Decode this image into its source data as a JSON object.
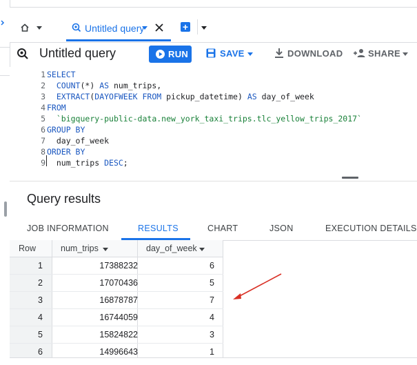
{
  "tabs": {
    "query_tab_label": "Untitled query"
  },
  "toolbar": {
    "title": "Untitled query",
    "run_label": "RUN",
    "save_label": "SAVE",
    "download_label": "DOWNLOAD",
    "share_label": "SHARE"
  },
  "editor": {
    "lines": [
      {
        "num": "1",
        "parts": [
          {
            "t": "kw",
            "v": "SELECT"
          }
        ]
      },
      {
        "num": "2",
        "parts": [
          {
            "t": "txt",
            "v": "  "
          },
          {
            "t": "kw",
            "v": "COUNT"
          },
          {
            "t": "txt",
            "v": "(*) "
          },
          {
            "t": "kw",
            "v": "AS"
          },
          {
            "t": "txt",
            "v": " num_trips,"
          }
        ]
      },
      {
        "num": "3",
        "parts": [
          {
            "t": "txt",
            "v": "  "
          },
          {
            "t": "kw",
            "v": "EXTRACT"
          },
          {
            "t": "txt",
            "v": "("
          },
          {
            "t": "kw",
            "v": "DAYOFWEEK FROM"
          },
          {
            "t": "txt",
            "v": " pickup_datetime) "
          },
          {
            "t": "kw",
            "v": "AS"
          },
          {
            "t": "txt",
            "v": " day_of_week"
          }
        ]
      },
      {
        "num": "4",
        "parts": [
          {
            "t": "kw",
            "v": "FROM"
          }
        ]
      },
      {
        "num": "5",
        "parts": [
          {
            "t": "txt",
            "v": "  "
          },
          {
            "t": "str",
            "v": "`bigquery-public-data.new_york_taxi_trips.tlc_yellow_trips_2017`"
          }
        ]
      },
      {
        "num": "6",
        "parts": [
          {
            "t": "kw",
            "v": "GROUP BY"
          }
        ]
      },
      {
        "num": "7",
        "parts": [
          {
            "t": "txt",
            "v": "  day_of_week"
          }
        ]
      },
      {
        "num": "8",
        "parts": [
          {
            "t": "kw",
            "v": "ORDER BY"
          }
        ]
      },
      {
        "num": "9",
        "parts": [
          {
            "t": "txt",
            "v": "  num_trips "
          },
          {
            "t": "kw",
            "v": "DESC"
          },
          {
            "t": "txt",
            "v": ";"
          }
        ]
      }
    ]
  },
  "results": {
    "title": "Query results",
    "tabs": [
      "JOB INFORMATION",
      "RESULTS",
      "CHART",
      "JSON",
      "EXECUTION DETAILS"
    ],
    "active_tab": "RESULTS",
    "columns": [
      "Row",
      "num_trips",
      "day_of_week"
    ],
    "rows": [
      [
        "1",
        "17388232",
        "6"
      ],
      [
        "2",
        "17070436",
        "5"
      ],
      [
        "3",
        "16878787",
        "7"
      ],
      [
        "4",
        "16744059",
        "4"
      ],
      [
        "5",
        "15824822",
        "3"
      ],
      [
        "6",
        "14996643",
        "1"
      ]
    ]
  },
  "colors": {
    "accent": "#1a73e8",
    "keyword": "#1a57c0",
    "string": "#188038",
    "arrow": "#d93025"
  }
}
